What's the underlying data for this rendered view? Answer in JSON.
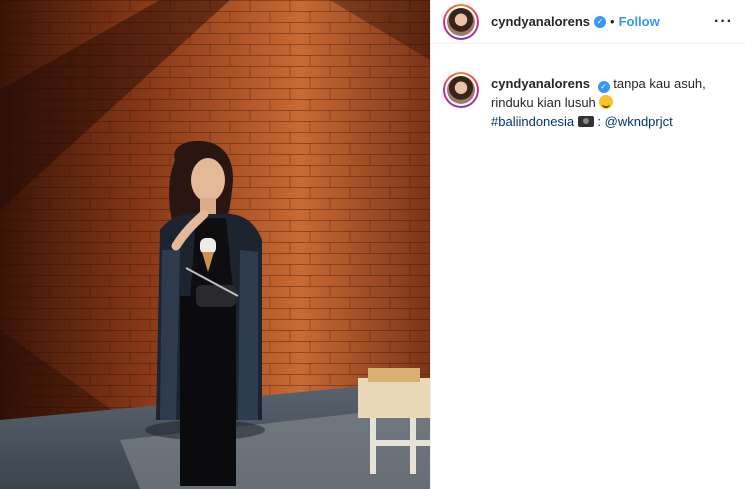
{
  "post": {
    "username": "cyndyanalorens",
    "follow_label": "Follow",
    "separator": "•",
    "more_label": "···",
    "caption": {
      "username": "cyndyanalorens",
      "line1": "tanpa kau asuh,",
      "line2": "rinduku kian lusuh",
      "hashtag": "#baliindonesia",
      "credit_sep": ":",
      "mention": "@wkndprjct"
    }
  },
  "colors": {
    "link": "#3897f0",
    "hashtag": "#00376b"
  },
  "icons": [
    "verified-badge-icon",
    "more-options-icon",
    "grinning-face-emoji-icon",
    "camera-emoji-icon"
  ]
}
